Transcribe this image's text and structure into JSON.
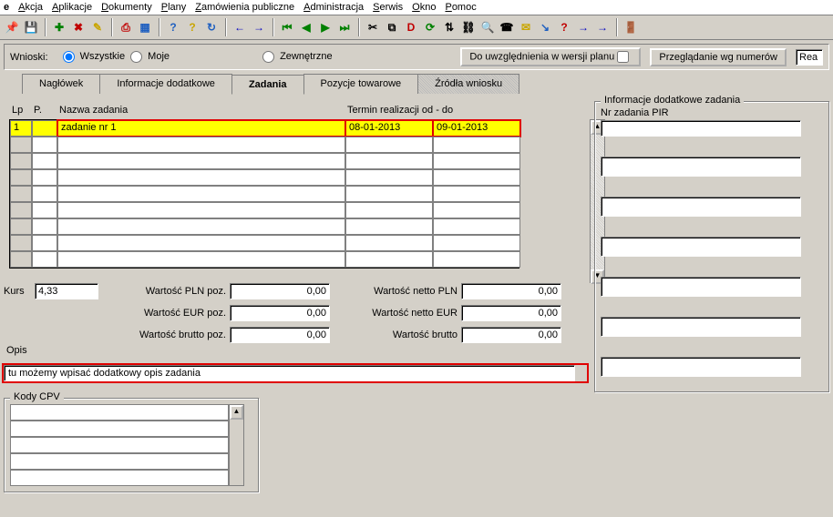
{
  "window": {
    "title_prefix": "e"
  },
  "menu": {
    "items": [
      {
        "u": "A",
        "rest": "kcja"
      },
      {
        "u": "A",
        "rest": "plikacje"
      },
      {
        "u": "D",
        "rest": "okumenty"
      },
      {
        "u": "P",
        "rest": "lany"
      },
      {
        "u": "Z",
        "rest": "amówienia publiczne"
      },
      {
        "u": "A",
        "rest": "dministracja"
      },
      {
        "u": "S",
        "rest": "erwis"
      },
      {
        "u": "O",
        "rest": "kno"
      },
      {
        "u": "P",
        "rest": "omoc"
      }
    ]
  },
  "toolbar_icons": [
    {
      "name": "pin-icon",
      "glyph": "📌",
      "color": "#c9a500"
    },
    {
      "name": "save-icon",
      "glyph": "💾",
      "color": "#000"
    },
    {
      "name": "sep"
    },
    {
      "name": "add-icon",
      "glyph": "✚",
      "color": "#008000"
    },
    {
      "name": "delete-icon",
      "glyph": "✖",
      "color": "#c00000"
    },
    {
      "name": "edit-icon",
      "glyph": "✎",
      "color": "#c9a500"
    },
    {
      "name": "sep"
    },
    {
      "name": "print-icon",
      "glyph": "⎙",
      "color": "#c00000"
    },
    {
      "name": "grid-icon",
      "glyph": "▦",
      "color": "#2060c0"
    },
    {
      "name": "sep"
    },
    {
      "name": "help-icon",
      "glyph": "?",
      "color": "#2060c0"
    },
    {
      "name": "help2-icon",
      "glyph": "?",
      "color": "#c9a500"
    },
    {
      "name": "refresh-icon",
      "glyph": "↻",
      "color": "#2060c0"
    },
    {
      "name": "sep"
    },
    {
      "name": "nav-back-icon",
      "glyph": "←",
      "color": "#0000c0"
    },
    {
      "name": "nav-fwd-icon",
      "glyph": "→",
      "color": "#0000c0"
    },
    {
      "name": "sep"
    },
    {
      "name": "first-icon",
      "glyph": "⏮",
      "color": "#008000"
    },
    {
      "name": "prev-icon",
      "glyph": "◀",
      "color": "#008000"
    },
    {
      "name": "next-icon",
      "glyph": "▶",
      "color": "#008000"
    },
    {
      "name": "last-icon",
      "glyph": "⏭",
      "color": "#008000"
    },
    {
      "name": "sep"
    },
    {
      "name": "cut-icon",
      "glyph": "✂",
      "color": "#000"
    },
    {
      "name": "copy-icon",
      "glyph": "⧉",
      "color": "#000"
    },
    {
      "name": "d-icon",
      "glyph": "D",
      "color": "#c00000"
    },
    {
      "name": "sync-icon",
      "glyph": "⟳",
      "color": "#008000"
    },
    {
      "name": "sort-icon",
      "glyph": "⇅",
      "color": "#000"
    },
    {
      "name": "link-icon",
      "glyph": "⛓",
      "color": "#000"
    },
    {
      "name": "search-icon",
      "glyph": "🔍",
      "color": "#000"
    },
    {
      "name": "phone-icon",
      "glyph": "☎",
      "color": "#000"
    },
    {
      "name": "mail-icon",
      "glyph": "✉",
      "color": "#c9a500"
    },
    {
      "name": "wand-icon",
      "glyph": "↘",
      "color": "#2060c0"
    },
    {
      "name": "help3-icon",
      "glyph": "?",
      "color": "#c00000"
    },
    {
      "name": "arrow-r1-icon",
      "glyph": "→",
      "color": "#0000c0"
    },
    {
      "name": "arrow-r2-icon",
      "glyph": "→",
      "color": "#0000c0"
    },
    {
      "name": "sep"
    },
    {
      "name": "exit-icon",
      "glyph": "🚪",
      "color": "#2060c0"
    }
  ],
  "filters": {
    "wnioski_label": "Wnioski:",
    "opts": [
      "Wszystkie",
      "Moje",
      "Zewnętrzne"
    ],
    "selected": "Wszystkie",
    "uwzglednienia_label": "Do uwzględnienia w wersji planu",
    "uwzglednienia_checked": false,
    "przegladanie_label": "Przeglądanie wg numerów",
    "search_value": "Rea"
  },
  "tabs": {
    "items": [
      "Nagłówek",
      "Informacje dodatkowe",
      "Zadania",
      "Pozycje towarowe",
      "Źródła wniosku"
    ],
    "active": "Zadania"
  },
  "grid": {
    "header_lp": "Lp",
    "header_p": "P.",
    "header_nazwa": "Nazwa zadania",
    "header_termin": "Termin realizacji od - do",
    "rows": [
      {
        "lp": "1",
        "p": "",
        "nazwa": "zadanie nr 1",
        "od": "08-01-2013",
        "do": "09-01-2013",
        "selected": true,
        "highlight": true
      }
    ],
    "empty_rows": 8
  },
  "values": {
    "kurs_label": "Kurs",
    "kurs": "4,33",
    "pln_poz_label": "Wartość PLN poz.",
    "pln_poz": "0,00",
    "eur_poz_label": "Wartość EUR poz.",
    "eur_poz": "0,00",
    "brutto_poz_label": "Wartość brutto poz.",
    "brutto_poz": "0,00",
    "netto_pln_label": "Wartość netto PLN",
    "netto_pln": "0,00",
    "netto_eur_label": "Wartość netto EUR",
    "netto_eur": "0,00",
    "brutto_label": "Wartość brutto",
    "brutto": "0,00"
  },
  "opis": {
    "label": "Opis",
    "value": "tu możemy wpisać dodatkowy opis zadania"
  },
  "cpv": {
    "legend": "Kody CPV",
    "rows": 5
  },
  "right": {
    "legend": "Informacje dodatkowe zadania",
    "nr_label": "Nr zadania PIR",
    "nr_value": "",
    "extra_fields": 6
  }
}
